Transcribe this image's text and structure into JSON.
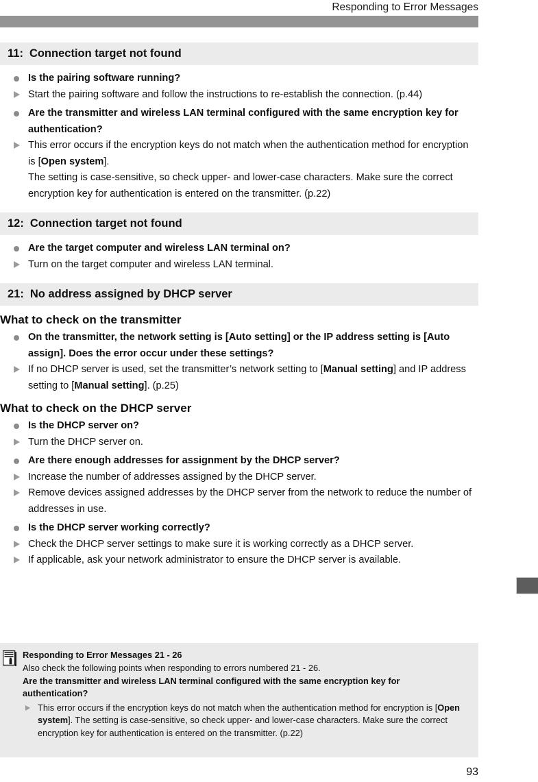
{
  "header": {
    "running_title": "Responding to Error Messages"
  },
  "sections": [
    {
      "number": "11:",
      "title": "Connection target not found",
      "items": [
        {
          "type": "question",
          "marker": "bullet-dot-icon",
          "text": "Is the pairing software running?"
        },
        {
          "type": "answer",
          "marker": "triangle-right-icon",
          "text": "Start the pairing software and follow the instructions to re-establish the connection. (p.44)"
        },
        {
          "type": "question",
          "marker": "bullet-dot-icon",
          "text": "Are the transmitter and wireless LAN terminal configured with the same encryption key for authentication?"
        },
        {
          "type": "answer",
          "marker": "triangle-right-icon",
          "html": "This error occurs if the encryption keys do not match when the authentication method for encryption is [<b>Open system</b>]."
        },
        {
          "type": "continuation",
          "text": "The setting is case-sensitive, so check upper- and lower-case characters. Make sure the correct encryption key for authentication is entered on the transmitter. (p.22)"
        }
      ]
    },
    {
      "number": "12:",
      "title": "Connection target not found",
      "items": [
        {
          "type": "question",
          "marker": "bullet-dot-icon",
          "text": "Are the target computer and wireless LAN terminal on?"
        },
        {
          "type": "answer",
          "marker": "triangle-right-icon",
          "text": "Turn on the target computer and wireless LAN terminal."
        }
      ]
    },
    {
      "number": "21:",
      "title": "No address assigned by DHCP server",
      "subsections": [
        {
          "heading": "What to check on the transmitter",
          "items": [
            {
              "type": "question",
              "marker": "bullet-dot-icon",
              "text": "On the transmitter, the network setting is [Auto setting] or the IP address setting is [Auto assign]. Does the error occur under these settings?"
            },
            {
              "type": "answer",
              "marker": "triangle-right-icon",
              "html": "If no DHCP server is used, set the transmitter’s network setting to [<b>Manual setting</b>] and IP address setting to [<b>Manual setting</b>]. (p.25)"
            }
          ]
        },
        {
          "heading": "What to check on the DHCP server",
          "items": [
            {
              "type": "question",
              "marker": "bullet-dot-icon",
              "text": "Is the DHCP server on?"
            },
            {
              "type": "answer",
              "marker": "triangle-right-icon",
              "text": "Turn the DHCP server on."
            },
            {
              "type": "question",
              "marker": "bullet-dot-icon",
              "text": "Are there enough addresses for assignment by the DHCP server?"
            },
            {
              "type": "answer",
              "marker": "triangle-right-icon",
              "text": "Increase the number of addresses assigned by the DHCP server."
            },
            {
              "type": "answer",
              "marker": "triangle-right-icon",
              "text": "Remove devices assigned addresses by the DHCP server from the network to reduce the number of addresses in use."
            },
            {
              "type": "question",
              "marker": "bullet-dot-icon",
              "text": "Is the DHCP server working correctly?"
            },
            {
              "type": "answer",
              "marker": "triangle-right-icon",
              "text": "Check the DHCP server settings to make sure it is working correctly as a DHCP server."
            },
            {
              "type": "answer",
              "marker": "triangle-right-icon",
              "text": "If applicable, ask your network administrator to ensure the DHCP server is available."
            }
          ]
        }
      ]
    }
  ],
  "note": {
    "icon": "memo-pad-icon",
    "title": "Responding to Error Messages 21 - 26",
    "intro": "Also check the following points when responding to errors numbered 21 - 26.",
    "bold_question": "Are the transmitter and wireless LAN terminal configured with the same encryption key for authentication?",
    "item_marker": "triangle-right-icon",
    "item_html": "This error occurs if the encryption keys do not match when the authentication method for encryption is [<b>Open system</b>]. The setting is case-sensitive, so check upper- and lower-case characters. Make sure the correct encryption key for authentication is entered on the transmitter. (p.22)"
  },
  "side_tab": {
    "name": "chapter-tab-marker",
    "color": "#5d5d5d"
  },
  "page_number": "93",
  "colors": {
    "header_rule": "#949494",
    "banner_bg": "#ebebeb",
    "note_bg": "#eaeaea",
    "marker_gray": "#8c8c8c"
  }
}
